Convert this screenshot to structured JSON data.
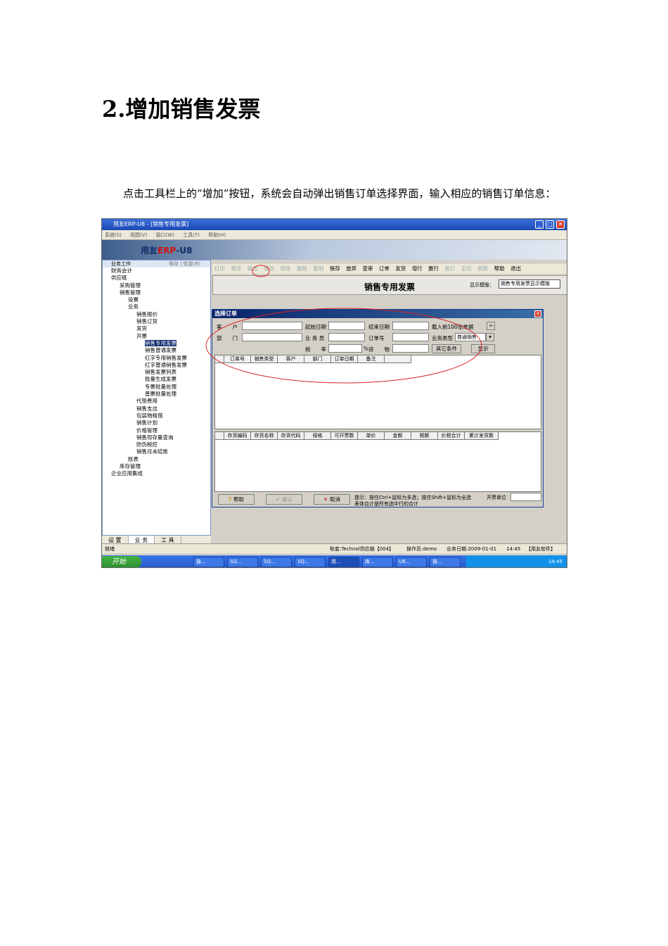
{
  "heading": "2.增加销售发票",
  "paragraph": "点击工具栏上的“增加”按钮，系统会自动弹出销售订单选择界面，输入相应的销售订单信息：",
  "app": {
    "title": "用友ERP-U8 - [销售专用发票]",
    "menu": [
      "系统(S)",
      "视图(V)",
      "窗口(W)",
      "工具(T)",
      "帮助(H)"
    ],
    "logo_text": "用友",
    "logo_erp": "ERP",
    "logo_suffix": "-U8"
  },
  "left_panel": {
    "header": "业务工作",
    "links": "保存 | 恢复(R)",
    "tree": [
      "财务会计",
      "供应链",
      "采购管理",
      "销售管理",
      "设置",
      "业务",
      "销售报价",
      "销售订货",
      "发货",
      "开票",
      "销售专用发票",
      "销售普通发票",
      "红字专用销售发票",
      "红字普通销售发票",
      "销售发票列表",
      "批量生成发票",
      "专票批量处理",
      "普票批量处理",
      "代垫费用",
      "销售支出",
      "包装物租借",
      "销售计划",
      "价格管理",
      "销售现存量查询",
      "防伪税控",
      "销售月末结账",
      "账表",
      "库存管理",
      "企业应用集成"
    ],
    "tabs": [
      "设 置",
      "业 务",
      "工 具"
    ]
  },
  "toolbar": {
    "disabled": [
      "打印",
      "预览",
      "输出",
      "增加",
      "修改",
      "删除",
      "复制"
    ],
    "enabled": [
      "保存",
      "放弃",
      "查审",
      "订单",
      "发货",
      "增行",
      "删行"
    ],
    "disabled2": [
      "批打",
      "定位",
      "刷新"
    ],
    "enabled2": [
      "帮助",
      "退出"
    ]
  },
  "document": {
    "title": "销售专用发票",
    "template_label": "显示模版：",
    "template_value": "销售专用发票显示模版"
  },
  "dialog": {
    "title": "选择订单",
    "fields": {
      "customer": "客　　户",
      "dept": "部　　门",
      "start_date": "起始日期",
      "salesman": "业 务 员",
      "tax_rate": "税　　率",
      "end_date": "结束日期",
      "order_no": "订单号",
      "goods": "货　　物",
      "load_label": "载入前100张单据",
      "biz_type_label": "业务类型",
      "biz_type_value": "普通销售"
    },
    "buttons": {
      "other": "其它条件",
      "show": "显示",
      "help": "帮助",
      "confirm": "确认",
      "cancel": "取消"
    },
    "upper_headers": [
      "订单号",
      "销售类型",
      "客户",
      "部门",
      "订单日期",
      "备注"
    ],
    "lower_headers": [
      "存货编码",
      "存货名称",
      "存货代码",
      "规格",
      "可开票数",
      "单价",
      "金额",
      "税额",
      "价税合计",
      "累计发货数"
    ],
    "hint": "提示：按住Ctrl+鼠标为多选；按住Shift+鼠标为全选",
    "hint2": "表体合计是所有选中行的合计",
    "invoice_unit_label": "开票单位"
  },
  "status": {
    "ready": "就绪",
    "account": "账套:Technol供应链【004】",
    "operator": "操作员:demo",
    "biz_date": "业务日期:2009-01-01",
    "time": "14:45",
    "company": "【用友软件】"
  },
  "taskbar": {
    "start": "开始",
    "tasks": [
      "操...",
      "SQ...",
      "SQ...",
      "SQ...",
      "用...",
      "库...",
      "U8...",
      "操..."
    ],
    "clock": "14:45"
  }
}
